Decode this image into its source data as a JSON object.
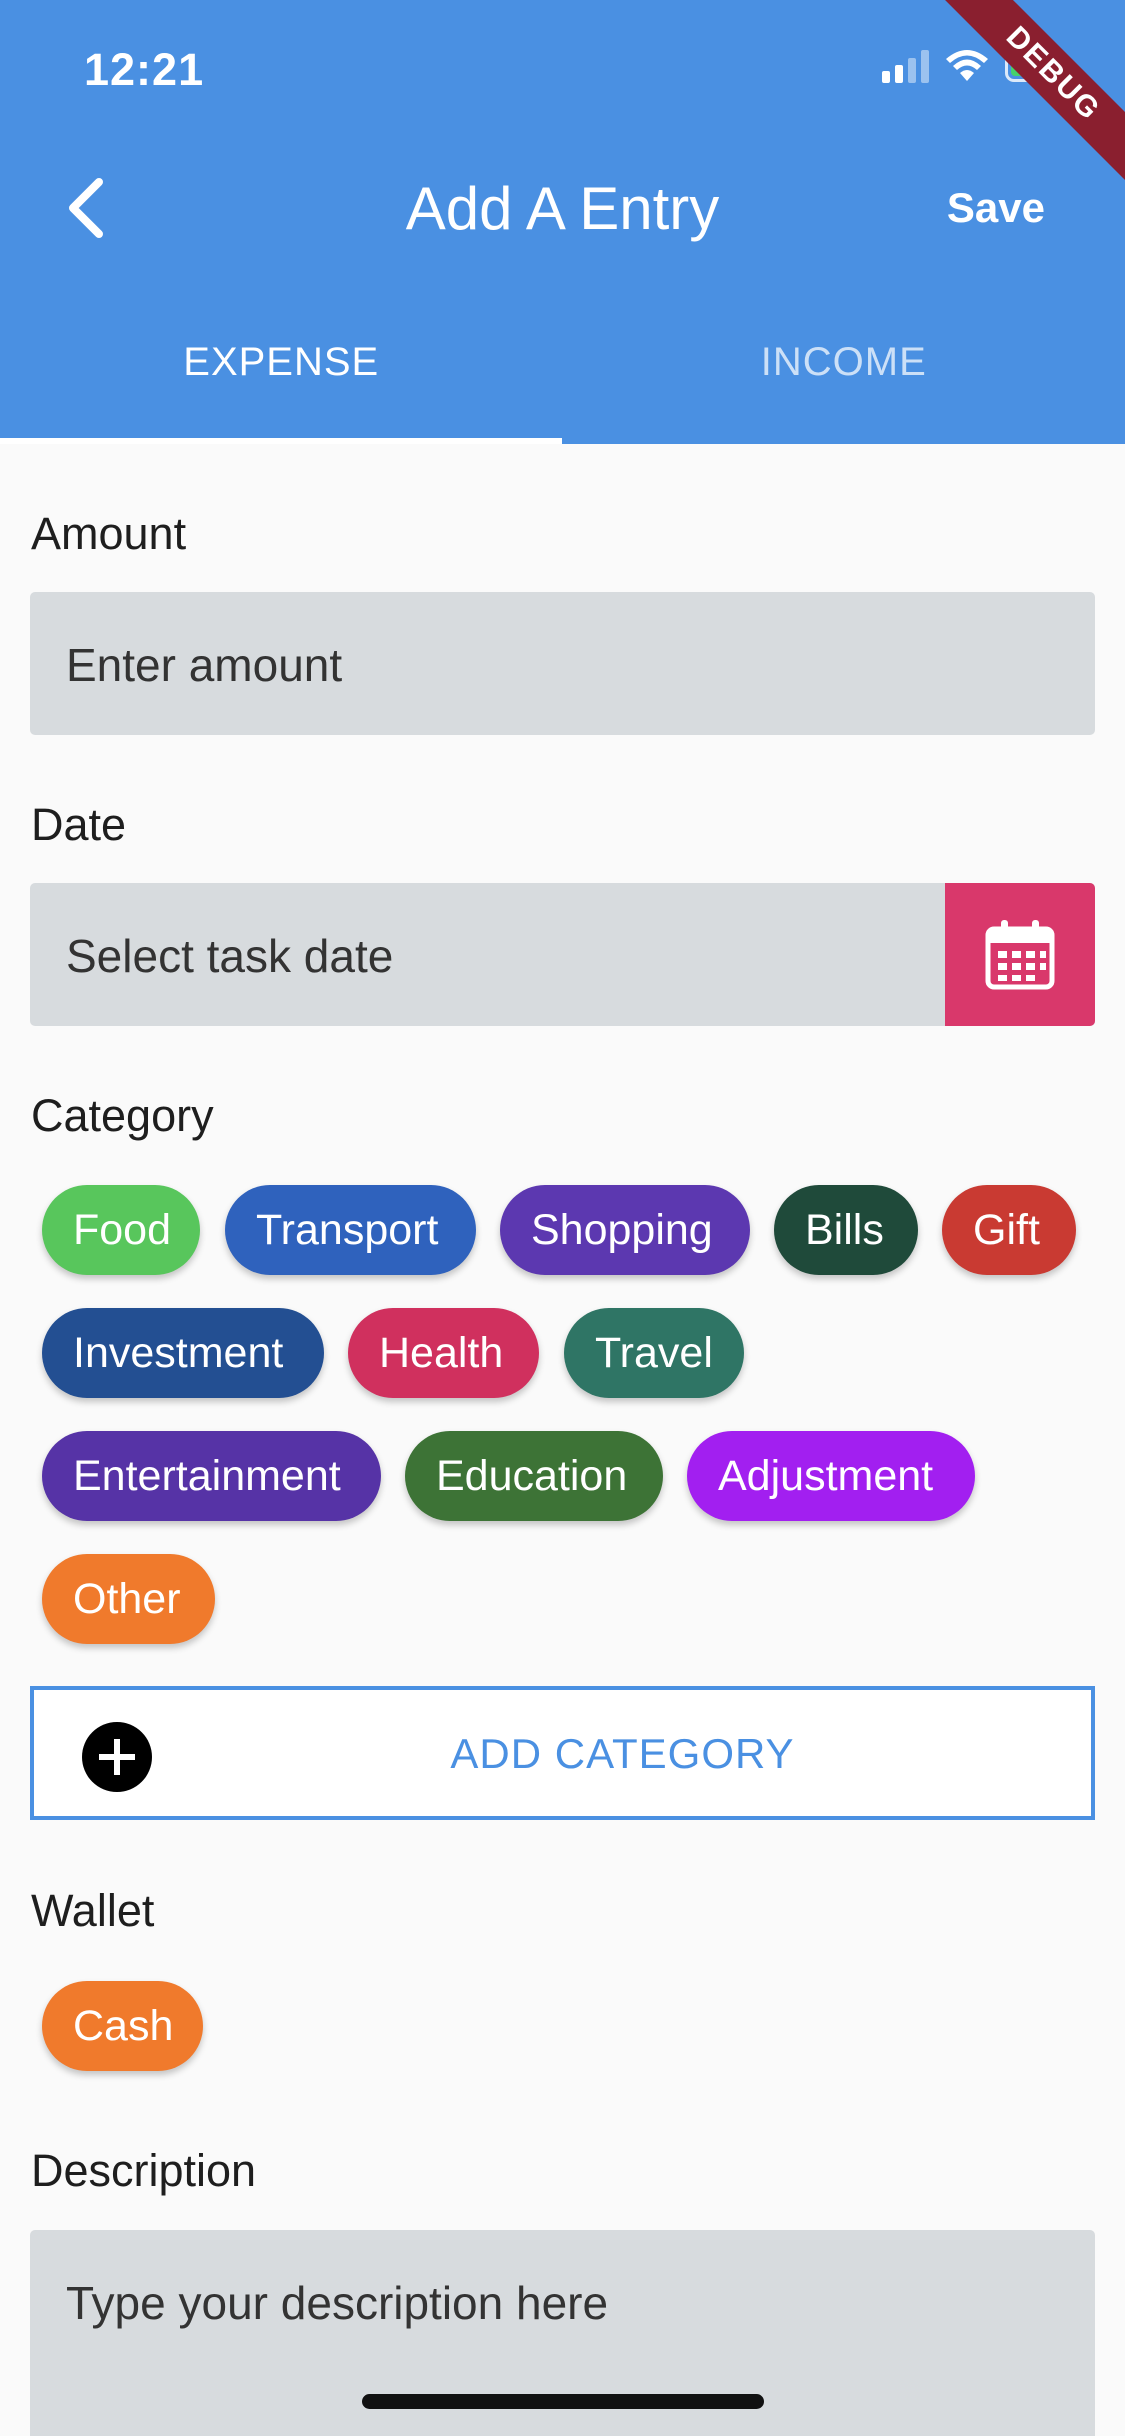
{
  "status_bar": {
    "time": "12:21",
    "debug_banner": "DEBUG"
  },
  "app_bar": {
    "title": "Add A Entry",
    "save_label": "Save",
    "back_icon": "chevron-left-icon"
  },
  "tabs": [
    {
      "label": "EXPENSE",
      "active": true
    },
    {
      "label": "INCOME",
      "active": false
    }
  ],
  "form": {
    "amount": {
      "label": "Amount",
      "placeholder": "Enter amount"
    },
    "date": {
      "label": "Date",
      "placeholder": "Select task date",
      "button_icon": "calendar-icon",
      "button_color": "#d9386b"
    },
    "category": {
      "label": "Category",
      "chips": [
        {
          "label": "Food",
          "color": "#58c65c"
        },
        {
          "label": "Transport",
          "color": "#2f62bd"
        },
        {
          "label": "Shopping",
          "color": "#5c38b0"
        },
        {
          "label": "Bills",
          "color": "#1f4a3a"
        },
        {
          "label": "Gift",
          "color": "#c93a32"
        },
        {
          "label": "Investment",
          "color": "#234f92"
        },
        {
          "label": "Health",
          "color": "#d0305e"
        },
        {
          "label": "Travel",
          "color": "#2f7565"
        },
        {
          "label": "Entertainment",
          "color": "#5633a6"
        },
        {
          "label": "Education",
          "color": "#3d7336"
        },
        {
          "label": "Adjustment",
          "color": "#a21ff0"
        },
        {
          "label": "Other",
          "color": "#f07a2c"
        }
      ],
      "add_label": "ADD CATEGORY"
    },
    "wallet": {
      "label": "Wallet",
      "chips": [
        {
          "label": "Cash",
          "color": "#f07a2c"
        }
      ]
    },
    "description": {
      "label": "Description",
      "placeholder": "Type your description here"
    }
  },
  "colors": {
    "primary": "#4a90e2",
    "background": "#fafafa",
    "field": "#d7dbde"
  }
}
